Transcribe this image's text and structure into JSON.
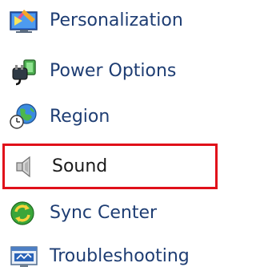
{
  "control_panel": {
    "items": [
      {
        "label": "Personalization",
        "icon": "personalization-icon"
      },
      {
        "label": "Power Options",
        "icon": "power-options-icon"
      },
      {
        "label": "Region",
        "icon": "region-icon"
      },
      {
        "label": "Sound",
        "icon": "sound-icon",
        "selected": true
      },
      {
        "label": "Sync Center",
        "icon": "sync-center-icon"
      },
      {
        "label": "Troubleshooting",
        "icon": "troubleshooting-icon"
      }
    ]
  },
  "colors": {
    "link_text": "#1e3d73",
    "selection_border": "#e0101a"
  }
}
